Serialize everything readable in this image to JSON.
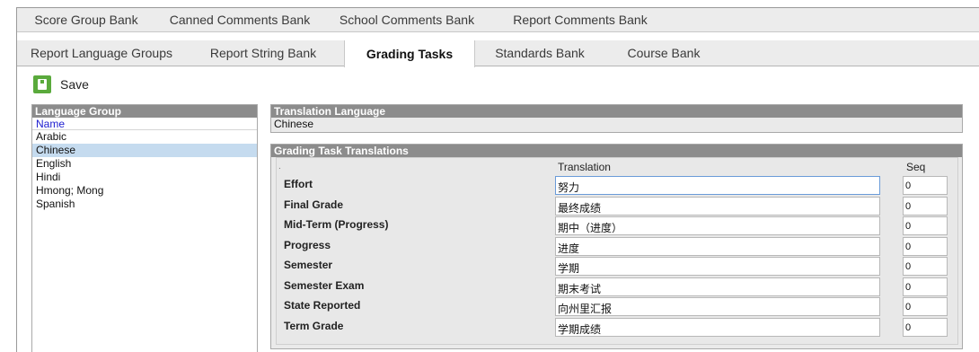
{
  "tabs_row1": [
    "Score Group Bank",
    "Canned Comments Bank",
    "School Comments Bank",
    "Report Comments Bank"
  ],
  "tabs_row2": [
    "Report Language Groups",
    "Report String Bank",
    "Grading Tasks",
    "Standards Bank",
    "Course Bank"
  ],
  "active_tab": "Grading Tasks",
  "toolbar": {
    "save_label": "Save"
  },
  "language_group": {
    "header": "Language Group",
    "column": "Name",
    "items": [
      "Arabic",
      "Chinese",
      "English",
      "Hindi",
      "Hmong; Mong",
      "Spanish"
    ],
    "selected": "Chinese"
  },
  "translation_language": {
    "header": "Translation Language",
    "value": "Chinese"
  },
  "grading_task_translations": {
    "header": "Grading Task Translations",
    "marker": ".",
    "col_translation": "Translation",
    "col_seq": "Seq",
    "rows": [
      {
        "name": "Effort",
        "translation": "努力",
        "seq": "0"
      },
      {
        "name": "Final Grade",
        "translation": "最终成绩",
        "seq": "0"
      },
      {
        "name": "Mid-Term (Progress)",
        "translation": "期中（进度）",
        "seq": "0"
      },
      {
        "name": "Progress",
        "translation": "进度",
        "seq": "0"
      },
      {
        "name": "Semester",
        "translation": "学期",
        "seq": "0"
      },
      {
        "name": "Semester Exam",
        "translation": "期末考试",
        "seq": "0"
      },
      {
        "name": "State Reported",
        "translation": "向州里汇报",
        "seq": "0"
      },
      {
        "name": "Term Grade",
        "translation": "学期成绩",
        "seq": "0"
      }
    ]
  },
  "colors": {
    "panel_header": "#8c8c8c",
    "selected_row": "#c5dbef",
    "save_icon": "#5aaa3c",
    "link_blue": "#2020d0"
  },
  "icons": {
    "save": "save-disk-icon"
  }
}
